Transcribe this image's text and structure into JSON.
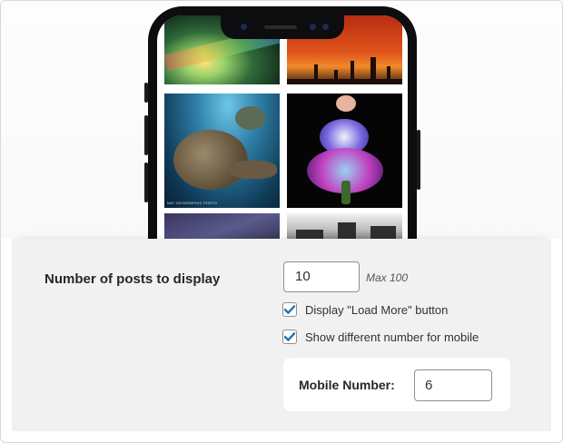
{
  "settings": {
    "posts_label": "Number of posts to display",
    "posts_value": "10",
    "posts_max_note": "Max 100",
    "load_more_label": "Display \"Load More\" button",
    "load_more_checked": true,
    "mobile_diff_label": "Show different number for mobile",
    "mobile_diff_checked": true,
    "mobile_number_label": "Mobile Number:",
    "mobile_number_value": "6"
  },
  "preview": {
    "caption_text": "NAT GEOGRAPHIC PHOTO"
  },
  "colors": {
    "checkbox_accent": "#2271b1",
    "panel_bg": "#f1f1f1"
  },
  "icons": {
    "checkmark": "checkmark-icon"
  }
}
